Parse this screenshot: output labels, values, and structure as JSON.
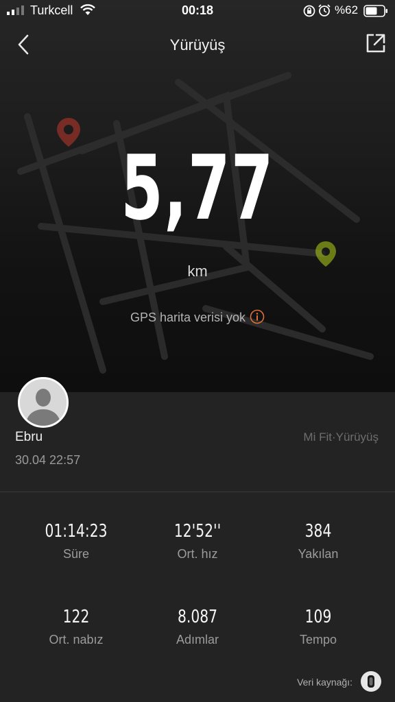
{
  "status_bar": {
    "carrier": "Turkcell",
    "time": "00:18",
    "battery": "%62"
  },
  "nav": {
    "title": "Yürüyüş"
  },
  "workout": {
    "distance": "5,77",
    "unit": "km",
    "gps_notice": "GPS harita verisi yok"
  },
  "user": {
    "name": "Ebru",
    "date": "30.04 22:57",
    "source_app": "Mi Fit·Yürüyüş"
  },
  "stats": [
    {
      "value": "01:14:23",
      "label": "Süre"
    },
    {
      "value": "12'52''",
      "label": "Ort. hız"
    },
    {
      "value": "384",
      "label": "Yakılan"
    },
    {
      "value": "122",
      "label": "Ort. nabız"
    },
    {
      "value": "8.087",
      "label": "Adımlar"
    },
    {
      "value": "109",
      "label": "Tempo"
    }
  ],
  "footer": {
    "data_source_label": "Veri kaynağı:"
  },
  "colors": {
    "background": "#232323",
    "accent_orange": "#e0703a",
    "start_marker": "#c0392b",
    "end_marker": "#a6c21a"
  },
  "icons": [
    "back-icon",
    "share-icon",
    "info-icon",
    "device-icon",
    "signal-icon",
    "wifi-icon",
    "lock-rotation-icon",
    "alarm-icon",
    "battery-icon"
  ]
}
